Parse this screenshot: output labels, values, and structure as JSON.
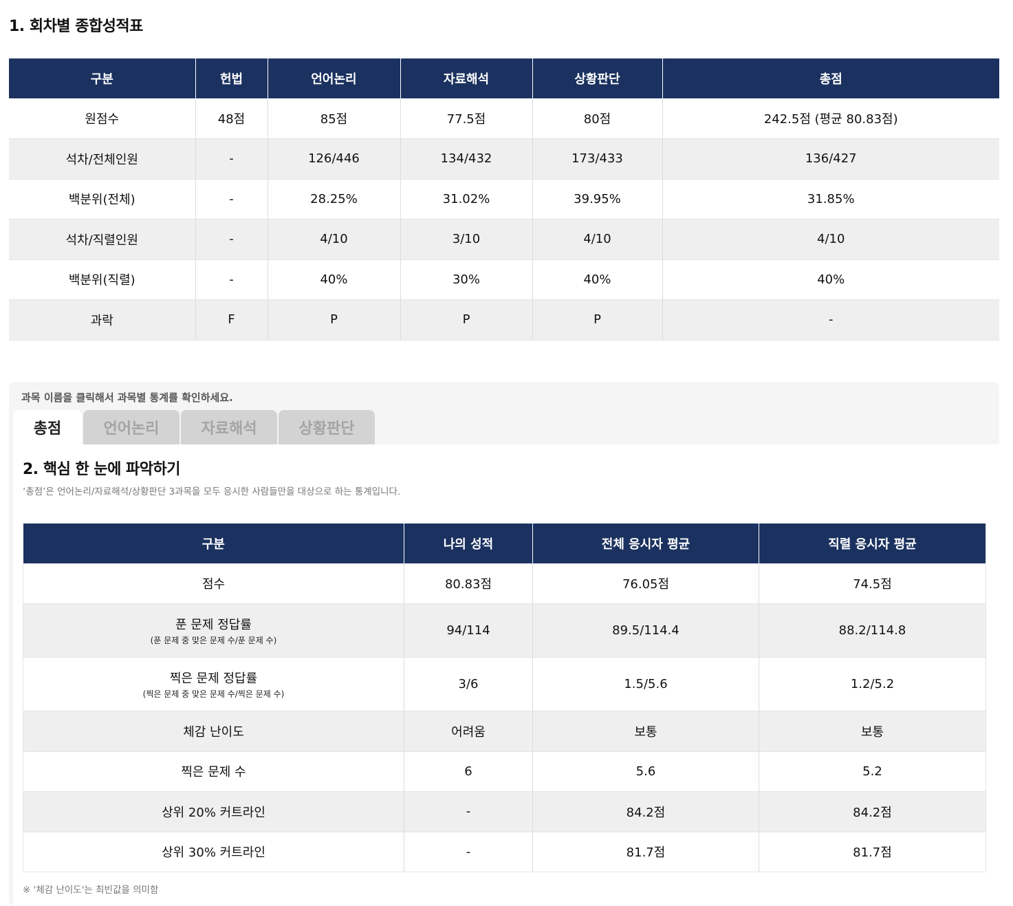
{
  "section1": {
    "title": "1. 회차별 종합성적표",
    "headers": [
      "구분",
      "헌법",
      "언어논리",
      "자료해석",
      "상황판단",
      "총점"
    ],
    "rows": [
      [
        "원점수",
        "48점",
        "85점",
        "77.5점",
        "80점",
        "242.5점 (평균 80.83점)"
      ],
      [
        "석차/전체인원",
        "-",
        "126/446",
        "134/432",
        "173/433",
        "136/427"
      ],
      [
        "백분위(전체)",
        "-",
        "28.25%",
        "31.02%",
        "39.95%",
        "31.85%"
      ],
      [
        "석차/직렬인원",
        "-",
        "4/10",
        "3/10",
        "4/10",
        "4/10"
      ],
      [
        "백분위(직렬)",
        "-",
        "40%",
        "30%",
        "40%",
        "40%"
      ],
      [
        "과락",
        "F",
        "P",
        "P",
        "P",
        "-"
      ]
    ]
  },
  "panel": {
    "hint": "과목 이름을 클릭해서 과목별 통계를 확인하세요.",
    "tabs": [
      "총점",
      "언어논리",
      "자료해석",
      "상황판단"
    ],
    "active_tab": "총점"
  },
  "section2": {
    "title": "2. 핵심 한 눈에 파악하기",
    "description": "‘총점’은 언어논리/자료해석/상황판단 3과목을 모두 응시한 사람들만을 대상으로 하는 통계입니다.",
    "headers": [
      "구분",
      "나의 성적",
      "전체 응시자 평균",
      "직렬 응시자 평균"
    ],
    "rows": [
      {
        "label": "점수",
        "sub": "",
        "values": [
          "80.83점",
          "76.05점",
          "74.5점"
        ]
      },
      {
        "label": "푼 문제 정답률",
        "sub": "(푼 문제 중 맞은 문제 수/푼 문제 수)",
        "values": [
          "94/114",
          "89.5/114.4",
          "88.2/114.8"
        ]
      },
      {
        "label": "찍은 문제 정답률",
        "sub": "(찍은 문제 중 맞은 문제 수/찍은 문제 수)",
        "values": [
          "3/6",
          "1.5/5.6",
          "1.2/5.2"
        ]
      },
      {
        "label": "체감 난이도",
        "sub": "",
        "values": [
          "어려움",
          "보통",
          "보통"
        ]
      },
      {
        "label": "찍은 문제 수",
        "sub": "",
        "values": [
          "6",
          "5.6",
          "5.2"
        ]
      },
      {
        "label": "상위 20% 커트라인",
        "sub": "",
        "values": [
          "-",
          "84.2점",
          "84.2점"
        ]
      },
      {
        "label": "상위 30% 커트라인",
        "sub": "",
        "values": [
          "-",
          "81.7점",
          "81.7점"
        ]
      }
    ],
    "footnote": "※ '체감 난이도'는 최빈값을 의미함"
  }
}
